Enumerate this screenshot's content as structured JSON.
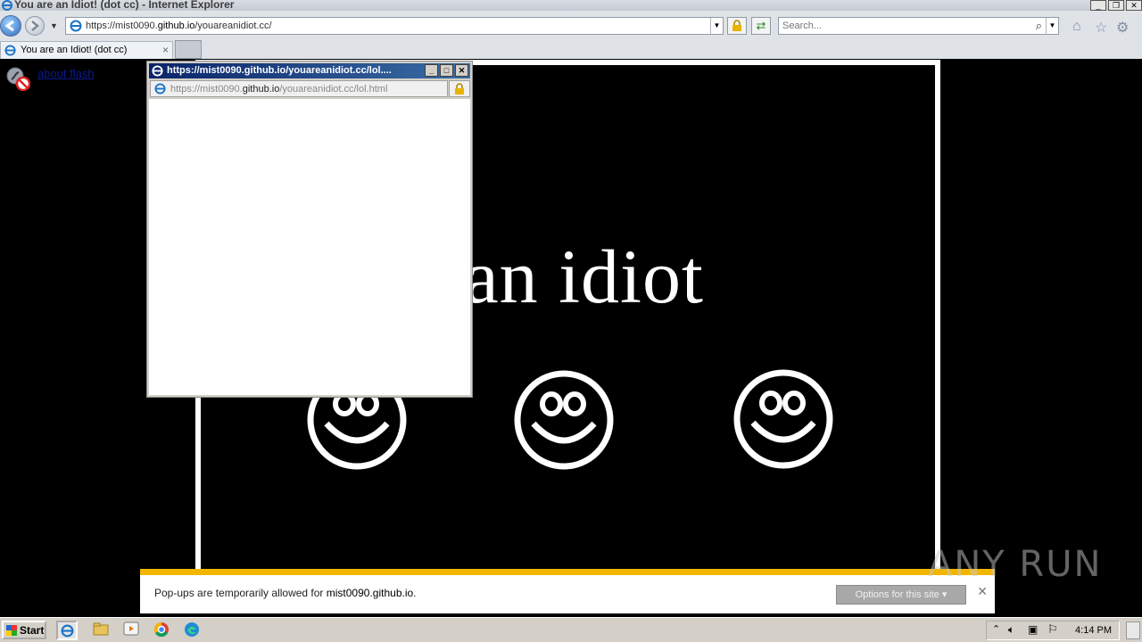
{
  "window": {
    "title": "You are an Idiot! (dot cc) - Internet Explorer"
  },
  "navbar": {
    "url_prefix": "https://",
    "url_host_a": "mist0090.",
    "url_host_b": "github.io",
    "url_path": "/youareanidiot.cc/",
    "search_placeholder": "Search..."
  },
  "tabs": [
    {
      "label": "You are an Idiot! (dot cc)"
    }
  ],
  "content": {
    "flash_link": "about flash",
    "headline": "are an idiot"
  },
  "popup": {
    "title": "https://mist0090.github.io/youareanidiot.cc/lol....",
    "url_prefix": "https://",
    "url_host_a": "mist0090.",
    "url_host_b": "github.io",
    "url_path": "/youareanidiot.cc/lol.html"
  },
  "notification": {
    "message_prefix": "Pop-ups are temporarily allowed for ",
    "message_site": "mist0090.github.io",
    "message_suffix": ".",
    "options_label": "Options for this site"
  },
  "watermark": "ANY RUN",
  "taskbar": {
    "start_label": "Start",
    "clock": "4:14 PM"
  },
  "colors": {
    "notification_accent": "#f2b600",
    "page_background": "#000000",
    "popup_title": "#0a246a"
  }
}
